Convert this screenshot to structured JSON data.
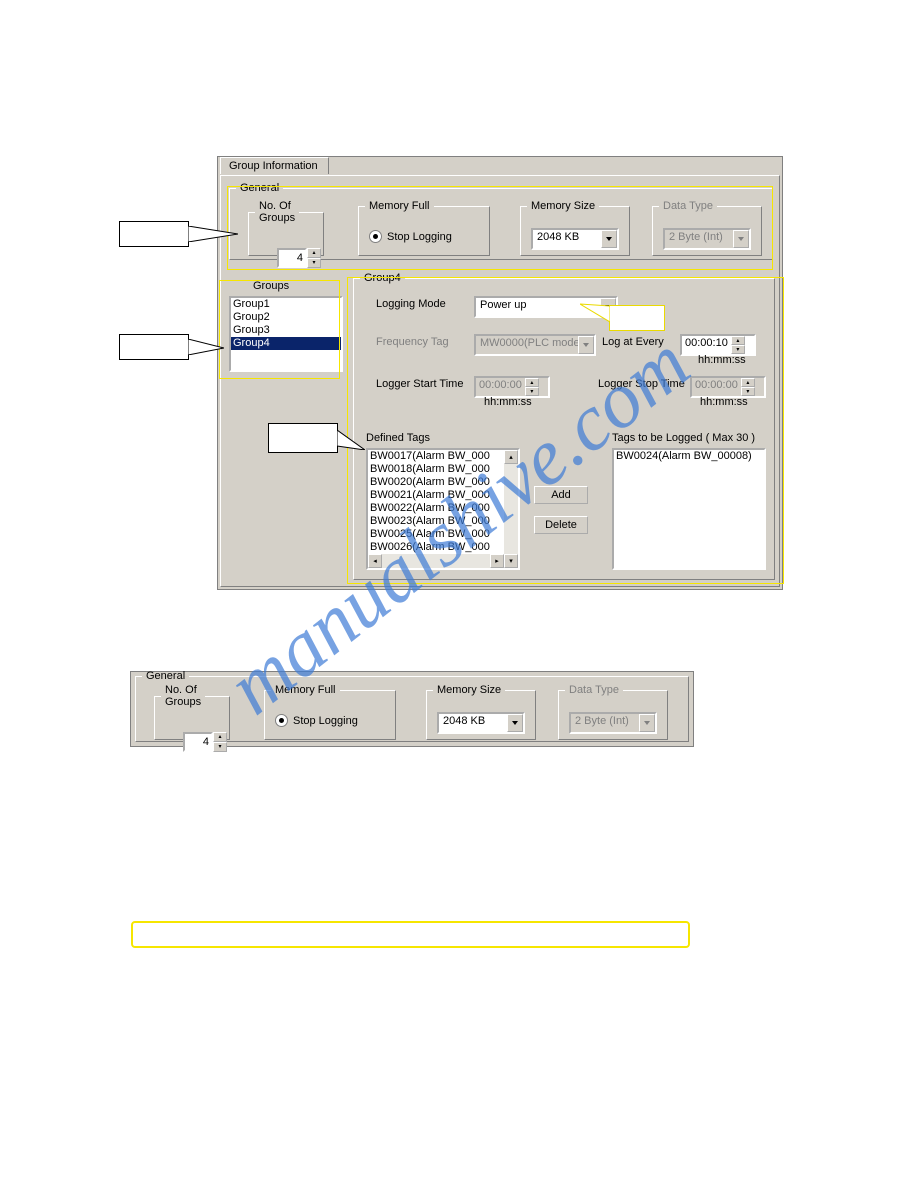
{
  "tab": "Group Information",
  "general": {
    "legend": "General",
    "noOfGroupsLabel": "No. Of\nGroups",
    "noOfGroups": "4",
    "memoryFullLegend": "Memory Full",
    "stopLogging": "Stop Logging",
    "memorySizeLegend": "Memory Size",
    "memorySize": "2048 KB",
    "dataTypeLegend": "Data Type",
    "dataType": "2 Byte (Int)"
  },
  "groups": {
    "label": "Groups",
    "items": [
      "Group1",
      "Group2",
      "Group3",
      "Group4"
    ],
    "selected": "Group4"
  },
  "group4": {
    "legend": "Group4",
    "loggingModeLabel": "Logging Mode",
    "loggingMode": "Power up",
    "frequencyTagLabel": "Frequency Tag",
    "frequencyTag": "MW0000(PLC mode",
    "logAtEveryLabel": "Log at Every",
    "logAtEvery": "00:00:10",
    "hhmmss": "hh:mm:ss",
    "loggerStartLabel": "Logger Start Time",
    "loggerStart": "00:00:00",
    "loggerStopLabel": "Logger Stop Time",
    "loggerStop": "00:00:00",
    "definedTagsLabel": "Defined Tags",
    "definedTags": [
      "BW0017(Alarm BW_000",
      "BW0018(Alarm BW_000",
      "BW0020(Alarm BW_000",
      "BW0021(Alarm BW_000",
      "BW0022(Alarm BW_000",
      "BW0023(Alarm BW_000",
      "BW0025(Alarm BW_000",
      "BW0026(Alarm BW_000"
    ],
    "tagsToBeLoggedLabel": "Tags to be Logged ( Max 30 )",
    "tagsToBeLogged": [
      "BW0024(Alarm BW_00008)"
    ],
    "addLabel": "Add",
    "deleteLabel": "Delete"
  }
}
